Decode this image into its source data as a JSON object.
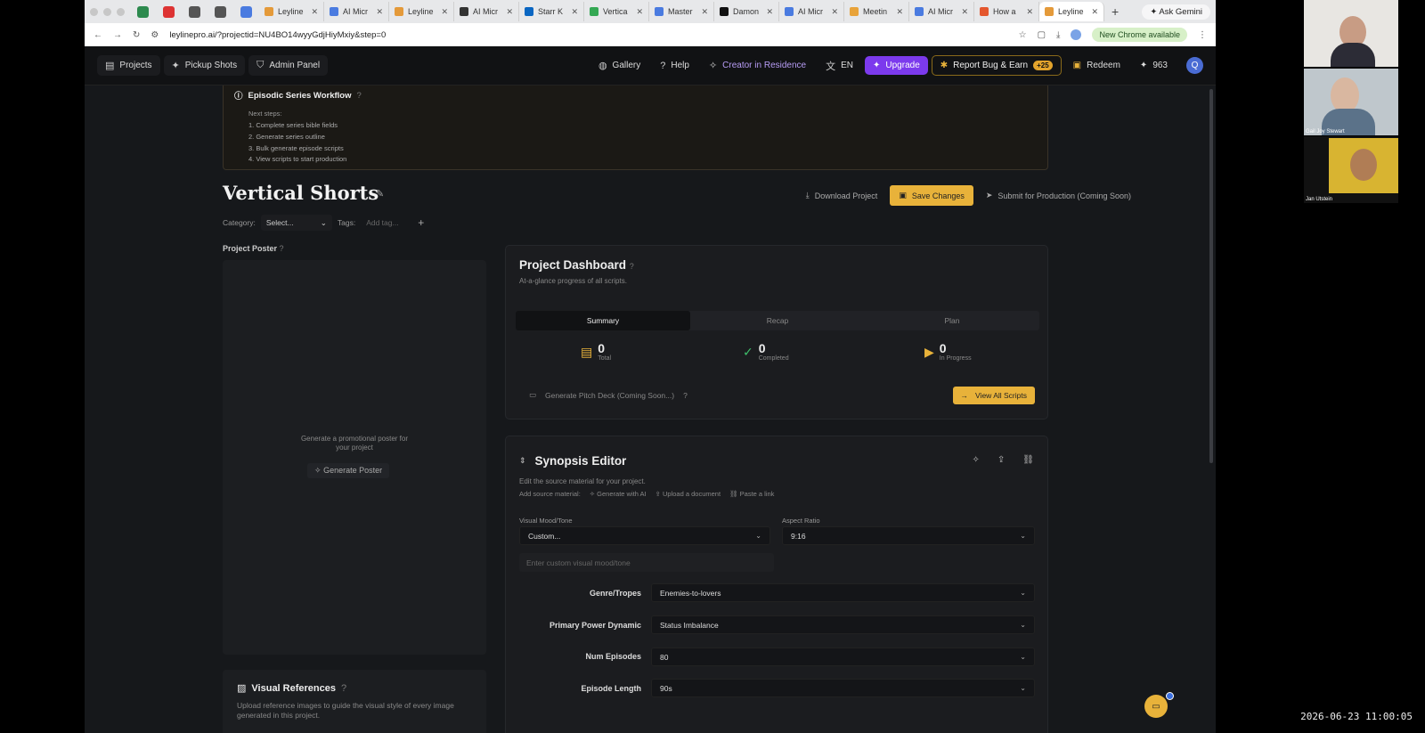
{
  "browser": {
    "tabs": [
      {
        "label": "Leyline",
        "color": "#e49a3a"
      },
      {
        "label": "AI Micr",
        "color": "#4a7be0"
      },
      {
        "label": "Leyline",
        "color": "#e49a3a"
      },
      {
        "label": "AI Micr",
        "color": "#333333"
      },
      {
        "label": "Starr K",
        "color": "#0a66c2"
      },
      {
        "label": "Vertica",
        "color": "#34a853"
      },
      {
        "label": "Master",
        "color": "#4a7be0"
      },
      {
        "label": "Damon",
        "color": "#111111"
      },
      {
        "label": "AI Micr",
        "color": "#4a7be0"
      },
      {
        "label": "Meetin",
        "color": "#e8a33a"
      },
      {
        "label": "AI Micr",
        "color": "#4a7be0"
      },
      {
        "label": "How a",
        "color": "#e4572e"
      },
      {
        "label": "Leyline",
        "color": "#e49a3a"
      }
    ],
    "gemini_label": "Ask Gemini",
    "url": "leylinepro.ai/?projectid=NU4BO14wyyGdjHiyMxiy&step=0",
    "new_chrome_label": "New Chrome available"
  },
  "nav": {
    "projects": "Projects",
    "pickup_shots": "Pickup Shots",
    "admin_panel": "Admin Panel",
    "gallery": "Gallery",
    "help": "Help",
    "creator": "Creator in Residence",
    "language": "EN",
    "upgrade": "Upgrade",
    "report": "Report Bug & Earn",
    "report_badge": "+25",
    "redeem": "Redeem",
    "credits": "963",
    "avatar_initial": "Q"
  },
  "workflow": {
    "title": "Episodic Series Workflow",
    "next_label": "Next steps:",
    "steps": [
      "1. Complete series bible fields",
      "2. Generate series outline",
      "3. Bulk generate episode scripts",
      "4. View scripts to start production"
    ]
  },
  "project": {
    "title": "Vertical Shorts",
    "category_label": "Category:",
    "category_value": "Select...",
    "tags_label": "Tags:",
    "tags_placeholder": "Add tag...",
    "add_tag": "+",
    "download": "Download Project",
    "save": "Save Changes",
    "submit": "Submit for Production (Coming Soon)"
  },
  "poster": {
    "label": "Project Poster",
    "prompt_line1": "Generate a promotional poster for",
    "prompt_line2": "your project",
    "button": "Generate Poster"
  },
  "visual_refs": {
    "title": "Visual References",
    "desc_line1": "Upload reference images to guide the visual style of every image",
    "desc_line2": "generated in this project."
  },
  "dashboard": {
    "title": "Project Dashboard",
    "subtitle": "At-a-glance progress of all scripts.",
    "tabs": [
      "Summary",
      "Recap",
      "Plan"
    ],
    "stats": [
      {
        "value": "0",
        "label": "Total",
        "color": "#e8b23a"
      },
      {
        "value": "0",
        "label": "Completed",
        "color": "#3fbf6a"
      },
      {
        "value": "0",
        "label": "In Progress",
        "color": "#e8b23a"
      }
    ],
    "pitch_deck": "Generate Pitch Deck (Coming Soon...)",
    "view_all": "View All Scripts"
  },
  "synopsis": {
    "title": "Synopsis Editor",
    "subtitle": "Edit the source material for your project.",
    "add_source_label": "Add source material:",
    "generate_ai": "Generate with AI",
    "upload_doc": "Upload a document",
    "paste_link": "Paste a link",
    "mood_label": "Visual Mood/Tone",
    "mood_value": "Custom...",
    "aspect_label": "Aspect Ratio",
    "aspect_value": "9:16",
    "custom_mood_placeholder": "Enter custom visual mood/tone",
    "fields": [
      {
        "label": "Genre/Tropes",
        "value": "Enemies-to-lovers"
      },
      {
        "label": "Primary Power Dynamic",
        "value": "Status Imbalance"
      },
      {
        "label": "Num Episodes",
        "value": "80"
      },
      {
        "label": "Episode Length",
        "value": "90s"
      }
    ]
  },
  "video_call": {
    "participant2": "Gail Joy Stewart",
    "participant3": "Jan Utstein"
  },
  "clock": "2026-06-23 11:00:05"
}
